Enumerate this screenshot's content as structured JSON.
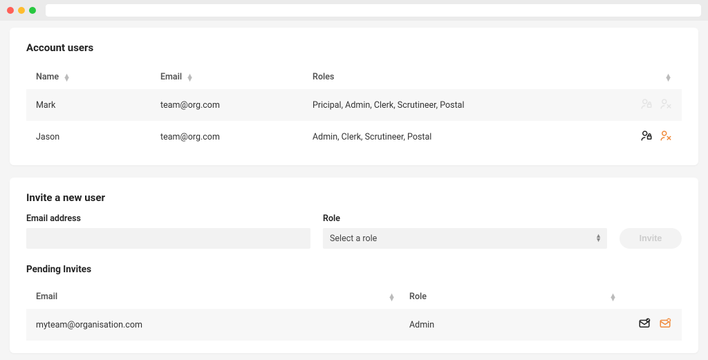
{
  "accentColor": "#f08a3a",
  "section_users": {
    "title": "Account users",
    "columns": {
      "name": "Name",
      "email": "Email",
      "roles": "Roles"
    },
    "rows": [
      {
        "name": "Mark",
        "email": "team@org.com",
        "roles": "Pricipal, Admin, Clerk, Scrutineer, Postal"
      },
      {
        "name": "Jason",
        "email": "team@org.com",
        "roles": "Admin, Clerk, Scrutineer, Postal"
      }
    ]
  },
  "section_invite": {
    "title": "Invite a new user",
    "email_label": "Email address",
    "role_label": "Role",
    "role_placeholder": "Select a role",
    "invite_button": "Invite"
  },
  "section_pending": {
    "title": "Pending Invites",
    "columns": {
      "email": "Email",
      "role": "Role"
    },
    "rows": [
      {
        "email": "myteam@organisation.com",
        "role": "Admin"
      }
    ]
  }
}
